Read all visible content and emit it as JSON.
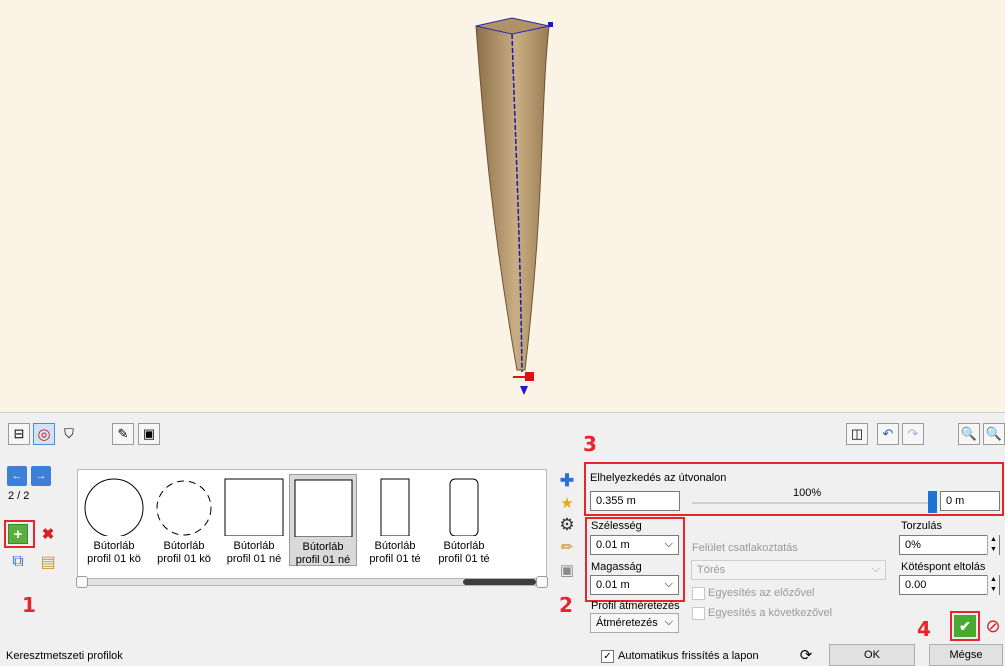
{
  "nav": {
    "counter": "2 / 2"
  },
  "profiles": [
    {
      "line1": "Bútorláb",
      "line2": "profil 01 kö",
      "shape": "circle"
    },
    {
      "line1": "Bútorláb",
      "line2": "profil 01 kö",
      "shape": "gear"
    },
    {
      "line1": "Bútorláb",
      "line2": "profil 01 né",
      "shape": "square"
    },
    {
      "line1": "Bútorláb",
      "line2": "profil 01 né",
      "shape": "square"
    },
    {
      "line1": "Bútorláb",
      "line2": "profil 01 té",
      "shape": "rect"
    },
    {
      "line1": "Bútorláb",
      "line2": "profil 01 té",
      "shape": "rounded-rect"
    }
  ],
  "selected_profile": 3,
  "path": {
    "label": "Elhelyezkedés az útvonalon",
    "position_value": "0.355 m",
    "percent": "100%",
    "slider_fraction": 1.0,
    "offset_value": "0 m"
  },
  "size": {
    "width_label": "Szélesség",
    "width_value": "0.01 m",
    "height_label": "Magasság",
    "height_value": "0.01 m"
  },
  "resize": {
    "label": "Profil átméretezés",
    "value": "Átméretezés"
  },
  "surface": {
    "label": "Felület csatlakoztatás",
    "value": "Törés",
    "merge_prev": "Egyesítés az előzővel",
    "merge_next": "Egyesítés a következővel"
  },
  "distortion": {
    "label": "Torzulás",
    "value": "0%"
  },
  "node_offset": {
    "label": "Kötéspont eltolás",
    "value": "0.00"
  },
  "status": {
    "title": "Keresztmetszeti profilok",
    "auto_refresh": "Automatikus frissítés a lapon",
    "ok": "OK",
    "cancel": "Mégse"
  },
  "callouts": {
    "n1": "1",
    "n2": "2",
    "n3": "3",
    "n4": "4"
  },
  "colors": {
    "accent": "#e8242f",
    "viewport_bg": "#fbf3e5",
    "leg_wood": "#a88b62",
    "path_line": "#1a1aa8"
  }
}
